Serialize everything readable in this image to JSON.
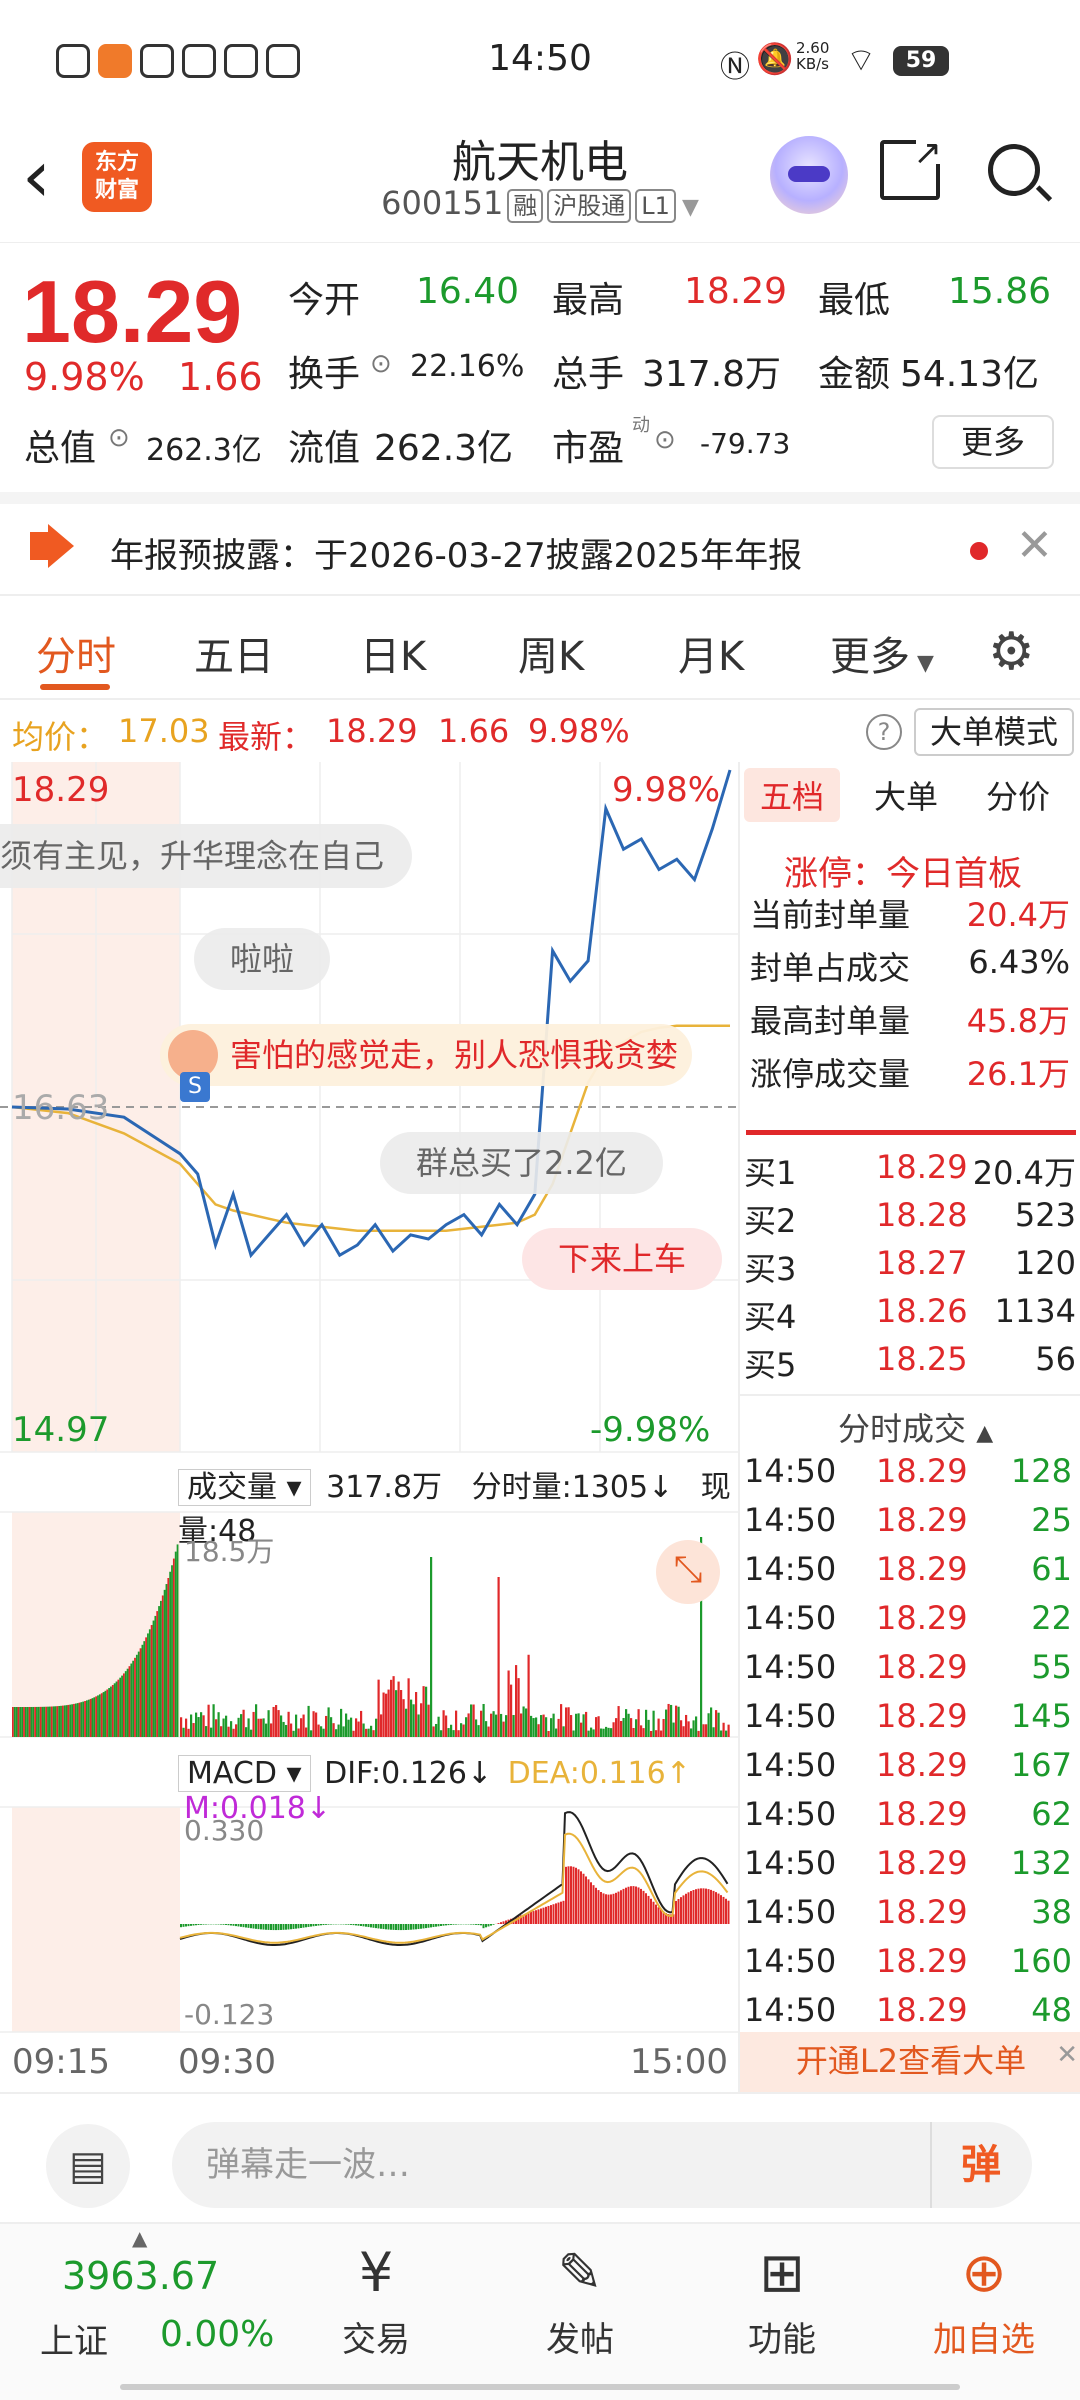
{
  "status_bar": {
    "time": "14:50",
    "net_speed": "2.60\nKB/s",
    "battery": "59"
  },
  "header": {
    "back_icon": "chevron-left-icon",
    "logo_text": "东方\n财富",
    "stock_name": "航天机电",
    "stock_code": "600151",
    "tags": [
      "融",
      "沪股通",
      "L1"
    ]
  },
  "quote": {
    "price": "18.29",
    "change_pct": "9.98%",
    "change": "1.66",
    "open_label": "今开",
    "open": "16.40",
    "high_label": "最高",
    "high": "18.29",
    "low_label": "最低",
    "low": "15.86",
    "turnover_label": "换手",
    "turnover": "22.16%",
    "volume_label": "总手",
    "volume": "317.8万",
    "amount_label": "金额",
    "amount": "54.13亿",
    "mktcap_label": "总值",
    "mktcap": "262.3亿",
    "float_label": "流值",
    "float_cap": "262.3亿",
    "pe_label": "市盈",
    "pe_sup": "动",
    "pe": "-79.73",
    "more": "更多"
  },
  "notice": {
    "text": "年报预披露：于2026-03-27披露2025年年报"
  },
  "tabs": [
    "分时",
    "五日",
    "日K",
    "周K",
    "月K",
    "更多"
  ],
  "avg_bar": {
    "avg_label": "均价：",
    "avg": "17.03",
    "latest_label": "最新：",
    "latest": "18.29",
    "latest_change": "1.66",
    "latest_pct": "9.98%",
    "big_order_mode": "大单模式"
  },
  "chart": {
    "top_price": "18.29",
    "bottom_price": "14.97",
    "top_pct": "9.98%",
    "bottom_pct": "-9.98%",
    "mid_price": "16.63",
    "danmu": [
      "须有主见，升华理念在自己",
      "啦啦",
      "害怕的感觉走，别人恐惧我贪婪",
      "群总买了2.2亿",
      "下来上车"
    ],
    "vol_label": "成交量",
    "vol_total": "317.8万",
    "vol_minute": "分时量:1305↓",
    "vol_now": "现量:48",
    "vol_max": "18.5万",
    "macd_label": "MACD",
    "dif": "DIF:0.126↓",
    "dea": "DEA:0.116↑",
    "m": "M:0.018↓",
    "macd_top": "0.330",
    "macd_bottom": "-0.123",
    "times": [
      "09:15",
      "09:30",
      "15:00"
    ]
  },
  "chart_data": {
    "type": "line",
    "x_range": [
      "09:15",
      "15:00"
    ],
    "ylim": [
      14.97,
      18.29
    ],
    "prev_close": 16.63,
    "series": [
      {
        "values": [
          16.63,
          16.62,
          16.58,
          16.4,
          16.3,
          15.95,
          16.2,
          15.9,
          16.0,
          16.1,
          15.95,
          16.05,
          15.9,
          15.95,
          16.05,
          15.92,
          16.0,
          15.98,
          16.05,
          16.1,
          16.0,
          16.15,
          16.05,
          16.2,
          17.4,
          17.25,
          17.35,
          18.1,
          17.9,
          17.95,
          17.8,
          17.85,
          17.75,
          18.0,
          18.29
        ]
      },
      {
        "values": [
          16.63,
          16.6,
          16.5,
          16.35,
          16.25,
          16.15,
          16.12,
          16.1,
          16.08,
          16.06,
          16.05,
          16.04,
          16.03,
          16.02,
          16.02,
          16.02,
          16.02,
          16.02,
          16.02,
          16.03,
          16.04,
          16.05,
          16.06,
          16.1,
          16.25,
          16.5,
          16.75,
          16.9,
          16.95,
          17.0,
          17.02,
          17.03,
          17.03,
          17.03,
          17.03
        ]
      }
    ]
  },
  "order_book": {
    "tabs": [
      "五档",
      "大单",
      "分价"
    ],
    "limit_up": "涨停：今日首板",
    "stats": [
      {
        "label": "当前封单量",
        "value": "20.4万"
      },
      {
        "label": "封单占成交",
        "value": "6.43%"
      },
      {
        "label": "最高封单量",
        "value": "45.8万"
      },
      {
        "label": "涨停成交量",
        "value": "26.1万"
      }
    ],
    "bids": [
      {
        "label": "买1",
        "price": "18.29",
        "qty": "20.4万"
      },
      {
        "label": "买2",
        "price": "18.28",
        "qty": "523"
      },
      {
        "label": "买3",
        "price": "18.27",
        "qty": "120"
      },
      {
        "label": "买4",
        "price": "18.26",
        "qty": "1134"
      },
      {
        "label": "买5",
        "price": "18.25",
        "qty": "56"
      }
    ],
    "trades_title": "分时成交",
    "trades": [
      {
        "time": "14:50",
        "price": "18.29",
        "qty": "128"
      },
      {
        "time": "14:50",
        "price": "18.29",
        "qty": "25"
      },
      {
        "time": "14:50",
        "price": "18.29",
        "qty": "61"
      },
      {
        "time": "14:50",
        "price": "18.29",
        "qty": "22"
      },
      {
        "time": "14:50",
        "price": "18.29",
        "qty": "55"
      },
      {
        "time": "14:50",
        "price": "18.29",
        "qty": "145"
      },
      {
        "time": "14:50",
        "price": "18.29",
        "qty": "167"
      },
      {
        "time": "14:50",
        "price": "18.29",
        "qty": "62"
      },
      {
        "time": "14:50",
        "price": "18.29",
        "qty": "132"
      },
      {
        "time": "14:50",
        "price": "18.29",
        "qty": "38"
      },
      {
        "time": "14:50",
        "price": "18.29",
        "qty": "160"
      },
      {
        "time": "14:50",
        "price": "18.29",
        "qty": "48"
      }
    ],
    "l2_banner": "开通L2查看大单"
  },
  "comment_bar": {
    "placeholder": "弹幕走一波…",
    "danmu_btn": "弹"
  },
  "bottom_nav": {
    "index_value": "3963.67",
    "index_name": "上证",
    "index_pct": "0.00%",
    "items": [
      {
        "label": "交易",
        "icon": "yuan-exchange-icon"
      },
      {
        "label": "发帖",
        "icon": "edit-icon"
      },
      {
        "label": "功能",
        "icon": "grid-icon"
      },
      {
        "label": "加自选",
        "icon": "plus-circle-icon"
      }
    ]
  },
  "colors": {
    "up": "#e02a2a",
    "down": "#1c9a2c",
    "accent": "#e2581f",
    "price_line": "#2b67b3",
    "avg_line": "#e8b33a"
  }
}
